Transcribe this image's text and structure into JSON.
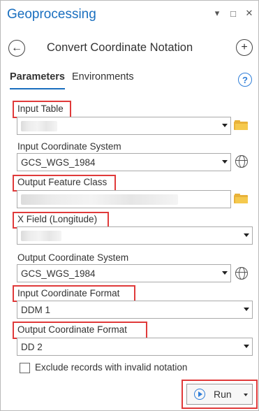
{
  "window": {
    "title": "Geoprocessing",
    "controls": [
      "chevron-down-icon",
      "restore-icon",
      "close-icon"
    ]
  },
  "tool": {
    "title": "Convert Coordinate Notation"
  },
  "tabs": [
    {
      "label": "Parameters",
      "active": true
    },
    {
      "label": "Environments",
      "active": false
    }
  ],
  "params": {
    "input_table": {
      "label": "Input Table",
      "value": ""
    },
    "input_coord_system": {
      "label": "Input Coordinate System",
      "value": "GCS_WGS_1984"
    },
    "output_feature_class": {
      "label": "Output Feature Class",
      "value": ""
    },
    "x_field": {
      "label": "X Field (Longitude)",
      "value": ""
    },
    "output_coord_system": {
      "label": "Output Coordinate System",
      "value": "GCS_WGS_1984"
    },
    "input_coord_format": {
      "label": "Input Coordinate Format",
      "value": "DDM 1"
    },
    "output_coord_format": {
      "label": "Output Coordinate Format",
      "value": "DD 2"
    }
  },
  "checkbox": {
    "label": "Exclude records with invalid notation",
    "checked": false
  },
  "run_button": {
    "label": "Run"
  },
  "colors": {
    "accent": "#1a6fbf",
    "highlight": "#e03a3a",
    "folder": "#e8b23a"
  }
}
